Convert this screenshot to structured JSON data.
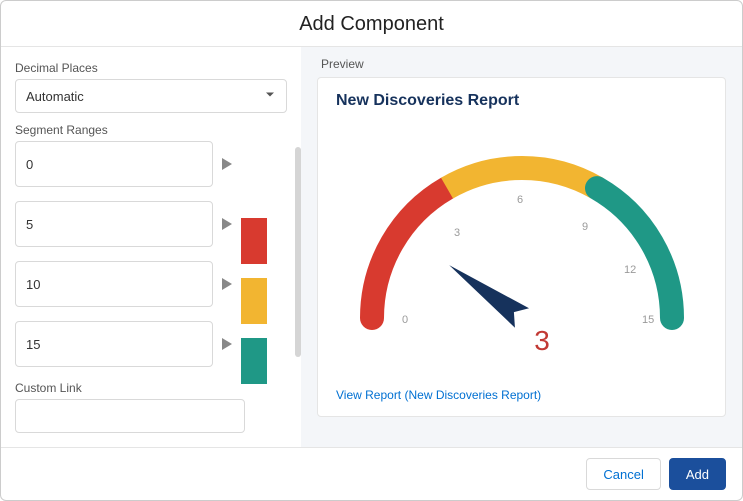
{
  "header": {
    "title": "Add Component"
  },
  "left": {
    "decimal_label": "Decimal Places",
    "decimal_value": "Automatic",
    "segment_label": "Segment Ranges",
    "segments": [
      "0",
      "5",
      "10",
      "15"
    ],
    "swatches": [
      "#d83a2f",
      "#f2b531",
      "#1f9886"
    ],
    "custom_link_label": "Custom Link",
    "custom_link_value": ""
  },
  "preview": {
    "label": "Preview",
    "title": "New Discoveries Report",
    "ticks": [
      "0",
      "3",
      "6",
      "9",
      "12",
      "15"
    ],
    "value": "3",
    "link": "View Report (New Discoveries Report)"
  },
  "footer": {
    "cancel": "Cancel",
    "add": "Add"
  },
  "chart_data": {
    "type": "gauge",
    "min": 0,
    "max": 15,
    "value": 3,
    "ticks": [
      0,
      3,
      6,
      9,
      12,
      15
    ],
    "segments": [
      {
        "from": 0,
        "to": 5,
        "color": "#d83a2f"
      },
      {
        "from": 5,
        "to": 10,
        "color": "#f2b531"
      },
      {
        "from": 10,
        "to": 15,
        "color": "#1f9886"
      }
    ],
    "title": "New Discoveries Report"
  }
}
